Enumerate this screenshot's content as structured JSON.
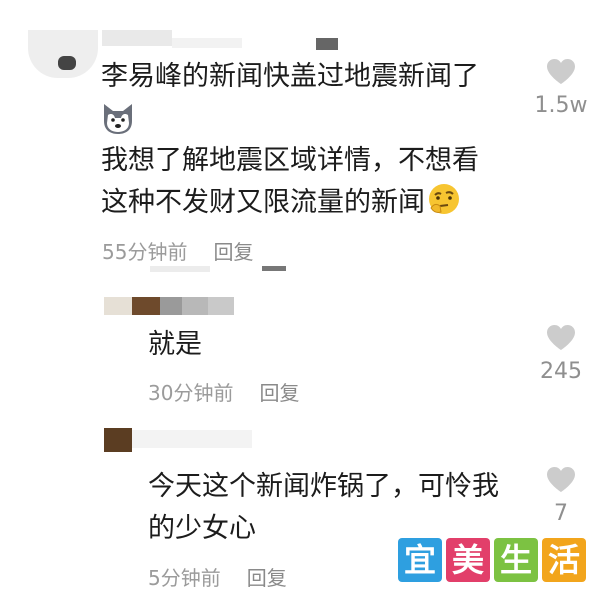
{
  "comments": [
    {
      "lines": [
        "李易峰的新闻快盖过地震新闻了"
      ],
      "emoji_line": "husky-emoji",
      "lines2": [
        "我想了解地震区域详情，不想看",
        "这种不发财又限流量的新闻"
      ],
      "trailing_emoji": "thinking-face-emoji",
      "time": "55分钟前",
      "reply": "回复",
      "likes": "1.5w"
    },
    {
      "lines": [
        "就是"
      ],
      "time": "30分钟前",
      "reply": "回复",
      "likes": "245"
    },
    {
      "lines": [
        "今天这个新闻炸锅了，可怜我",
        "的少女心"
      ],
      "time": "5分钟前",
      "reply": "回复",
      "likes": "7"
    }
  ],
  "icons": {
    "like": "heart-icon"
  },
  "watermark": {
    "chars": [
      "宜",
      "美",
      "生",
      "活"
    ],
    "colors": [
      "#2e9fe0",
      "#e23f6a",
      "#7cc242",
      "#f2a51c"
    ]
  }
}
